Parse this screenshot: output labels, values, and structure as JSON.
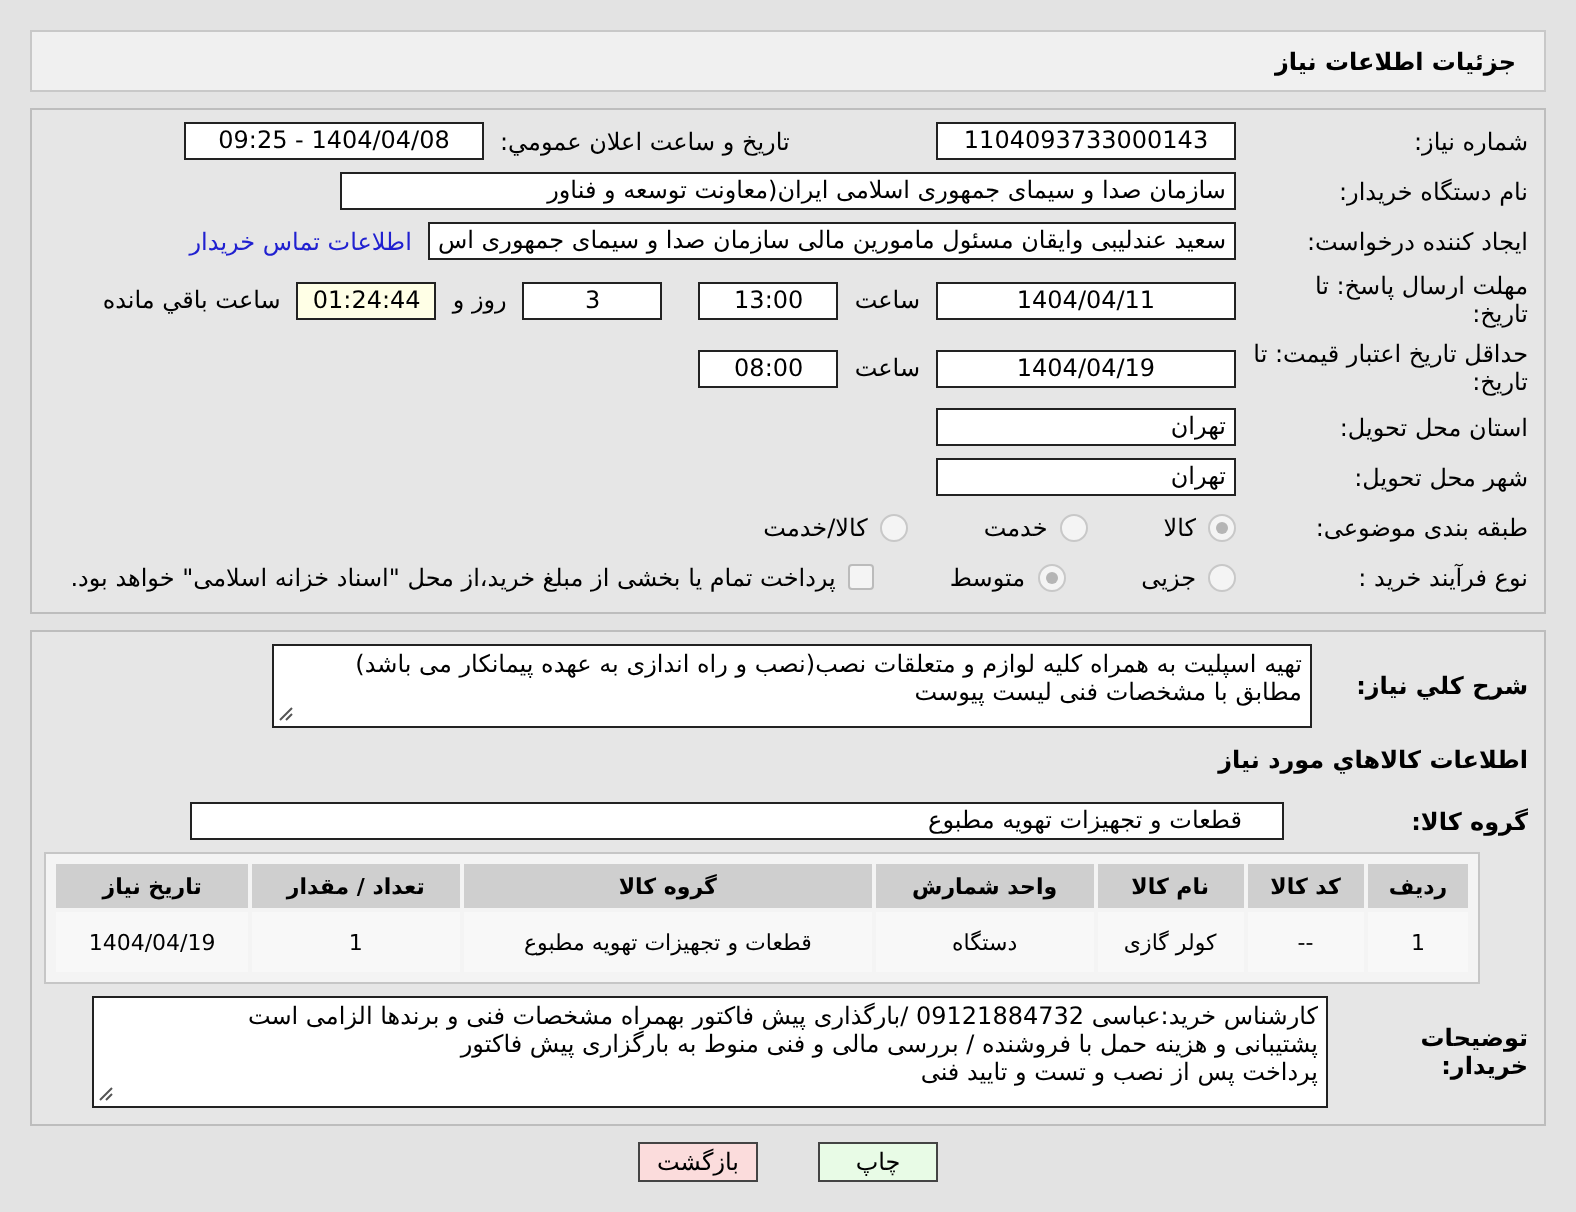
{
  "page_title": "جزئیات اطلاعات نیاز",
  "need_number": {
    "label": "شماره نیاز:",
    "value": "1104093733000143"
  },
  "announce": {
    "label": "تاریخ و ساعت اعلان عمومي:",
    "value": "1404/04/08 - 09:25"
  },
  "buyer_org": {
    "label": "نام دستگاه خریدار:",
    "value": "سازمان صدا و سیمای جمهوری اسلامی ایران(معاونت توسعه و فناور"
  },
  "requester": {
    "label": "ایجاد کننده درخواست:",
    "value": "سعید عندلیبی وایقان مسئول مامورین مالی  سازمان صدا و سیمای جمهوری اس",
    "link": "اطلاعات تماس خریدار"
  },
  "reply_deadline": {
    "label": "مهلت ارسال پاسخ: تا تاریخ:",
    "date": "1404/04/11",
    "time_label": "ساعت",
    "time": "13:00",
    "days": "3",
    "days_label": "روز و",
    "remaining": "01:24:44",
    "remaining_label": "ساعت باقي مانده"
  },
  "price_validity": {
    "label": "حداقل تاریخ اعتبار قیمت: تا تاریخ:",
    "date": "1404/04/19",
    "time_label": "ساعت",
    "time": "08:00"
  },
  "province": {
    "label": "استان محل تحویل:",
    "value": "تهران"
  },
  "city": {
    "label": "شهر محل تحویل:",
    "value": "تهران"
  },
  "category": {
    "label": "طبقه بندی موضوعی:",
    "options": [
      {
        "label": "کالا",
        "selected": true
      },
      {
        "label": "خدمت",
        "selected": false
      },
      {
        "label": "کالا/خدمت",
        "selected": false
      }
    ]
  },
  "process": {
    "label": "نوع فرآیند خرید :",
    "options": [
      {
        "label": "جزیی",
        "selected": false
      },
      {
        "label": "متوسط",
        "selected": true
      }
    ],
    "treasury": {
      "checked": false,
      "label": "پرداخت تمام یا بخشی از مبلغ خرید،از محل \"اسناد خزانه اسلامی\" خواهد بود."
    }
  },
  "description": {
    "label": "شرح کلي نیاز:",
    "value": "تهیه اسپلیت به همراه کلیه لوازم و متعلقات نصب(نصب و راه اندازی به عهده پیمانکار می باشد) مطابق با مشخصات فنی لیست پیوست"
  },
  "goods_title": "اطلاعات کالاهاي مورد نیاز",
  "goods_group": {
    "label": "گروه کالا:",
    "value": "قطعات و تجهیزات تهویه مطبوع"
  },
  "table": {
    "columns": [
      "ردیف",
      "کد کالا",
      "نام کالا",
      "واحد شمارش",
      "گروه کالا",
      "تعداد / مقدار",
      "تاریخ نیاز"
    ],
    "rows": [
      [
        "1",
        "--",
        "کولر گازی",
        "دستگاه",
        "قطعات و تجهیزات تهویه مطبوع",
        "1",
        "1404/04/19"
      ]
    ]
  },
  "buyer_notes": {
    "label": "توضیحات خریدار:",
    "lines": [
      "کارشناس خرید:عباسی 09121884732 /بارگذاری پیش فاکتور بهمراه مشخصات فنی و برندها الزامی است",
      "پشتیبانی و هزینه حمل با فروشنده / بررسی مالی و فنی منوط به بارگزاری پیش فاکتور",
      "پرداخت پس از نصب و تست و تایید فنی"
    ]
  },
  "buttons": [
    {
      "label": "چاپ",
      "kind": "print"
    },
    {
      "label": "بازگشت",
      "kind": "back"
    }
  ]
}
